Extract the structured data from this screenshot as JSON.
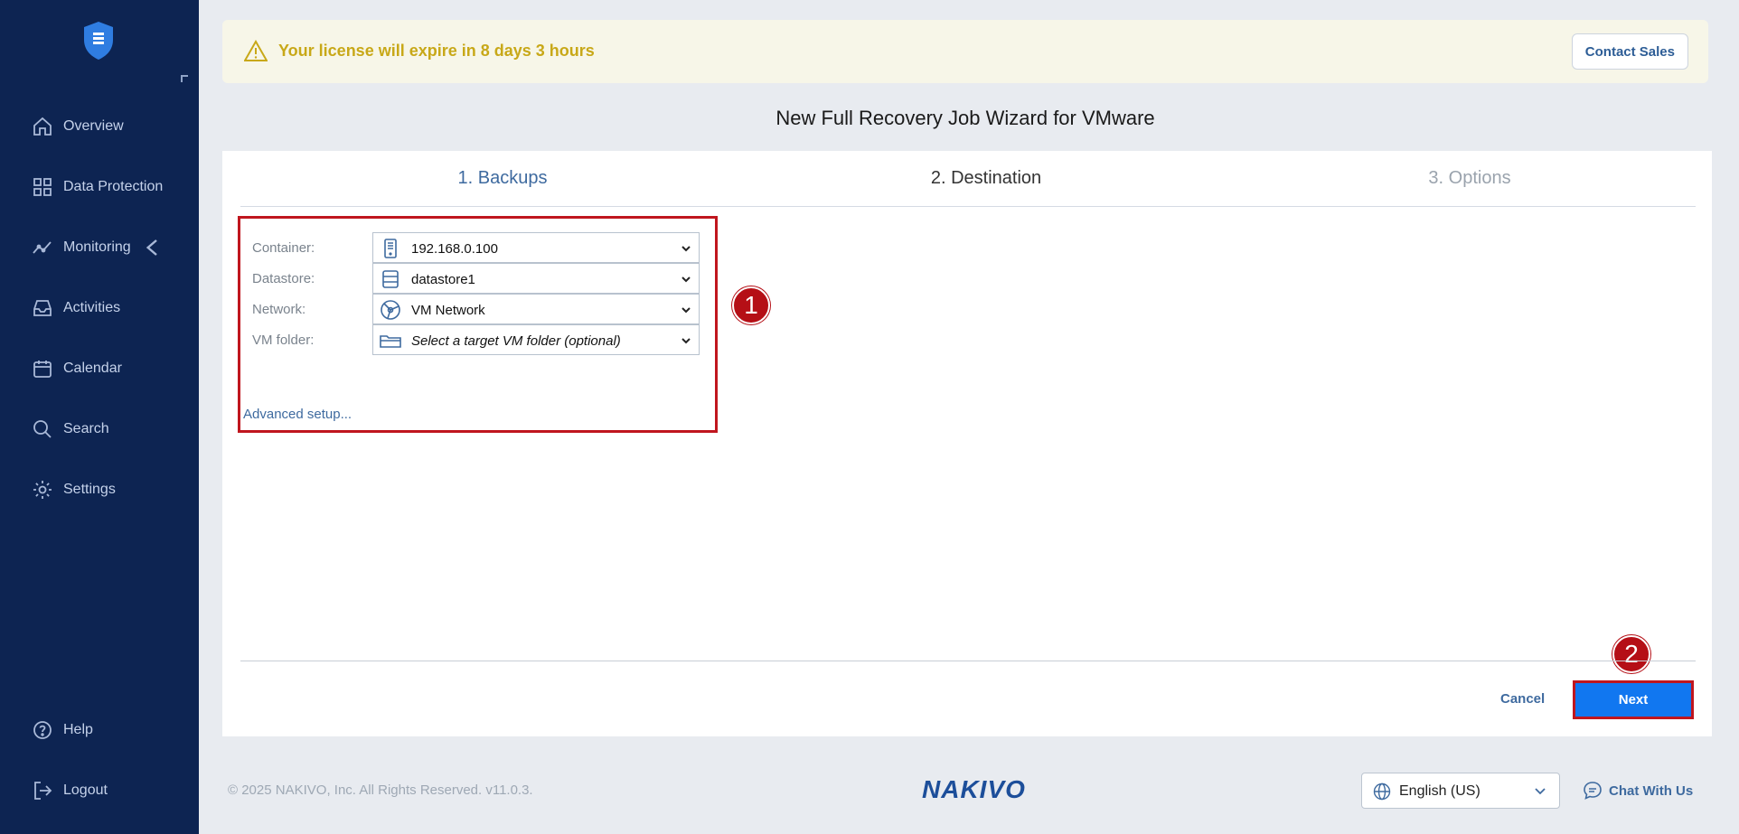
{
  "sidebar": {
    "items": [
      {
        "label": "Overview",
        "icon": "home-icon"
      },
      {
        "label": "Data Protection",
        "icon": "grid-icon"
      },
      {
        "label": "Monitoring",
        "icon": "chart-line-icon"
      },
      {
        "label": "Activities",
        "icon": "inbox-icon"
      },
      {
        "label": "Calendar",
        "icon": "calendar-icon"
      },
      {
        "label": "Search",
        "icon": "search-icon"
      },
      {
        "label": "Settings",
        "icon": "gear-icon"
      }
    ],
    "bottom": [
      {
        "label": "Help",
        "icon": "help-icon"
      },
      {
        "label": "Logout",
        "icon": "logout-icon"
      }
    ]
  },
  "banner": {
    "message": "Your license will expire in 8 days 3 hours",
    "contact_label": "Contact Sales"
  },
  "wizard": {
    "title": "New Full Recovery Job Wizard for VMware",
    "steps": [
      "1. Backups",
      "2. Destination",
      "3. Options"
    ],
    "fields": [
      {
        "label": "Container:",
        "value": "192.168.0.100",
        "icon": "server-icon"
      },
      {
        "label": "Datastore:",
        "value": "datastore1",
        "icon": "datastore-icon"
      },
      {
        "label": "Network:",
        "value": "VM Network",
        "icon": "network-icon"
      },
      {
        "label": "VM folder:",
        "value": "Select a target VM folder (optional)",
        "icon": "folder-icon"
      }
    ],
    "advanced_label": "Advanced setup...",
    "cancel_label": "Cancel",
    "next_label": "Next",
    "annotation_1": "1",
    "annotation_2": "2"
  },
  "footer": {
    "copyright": "© 2025 NAKIVO, Inc. All Rights Reserved. v11.0.3.",
    "brand": "NAKIVO",
    "language": "English (US)",
    "chat_label": "Chat With Us"
  },
  "colors": {
    "sidebar_bg": "#0d2452",
    "accent": "#1177f0",
    "annotation": "#b50f16",
    "warning": "#c8a818"
  }
}
